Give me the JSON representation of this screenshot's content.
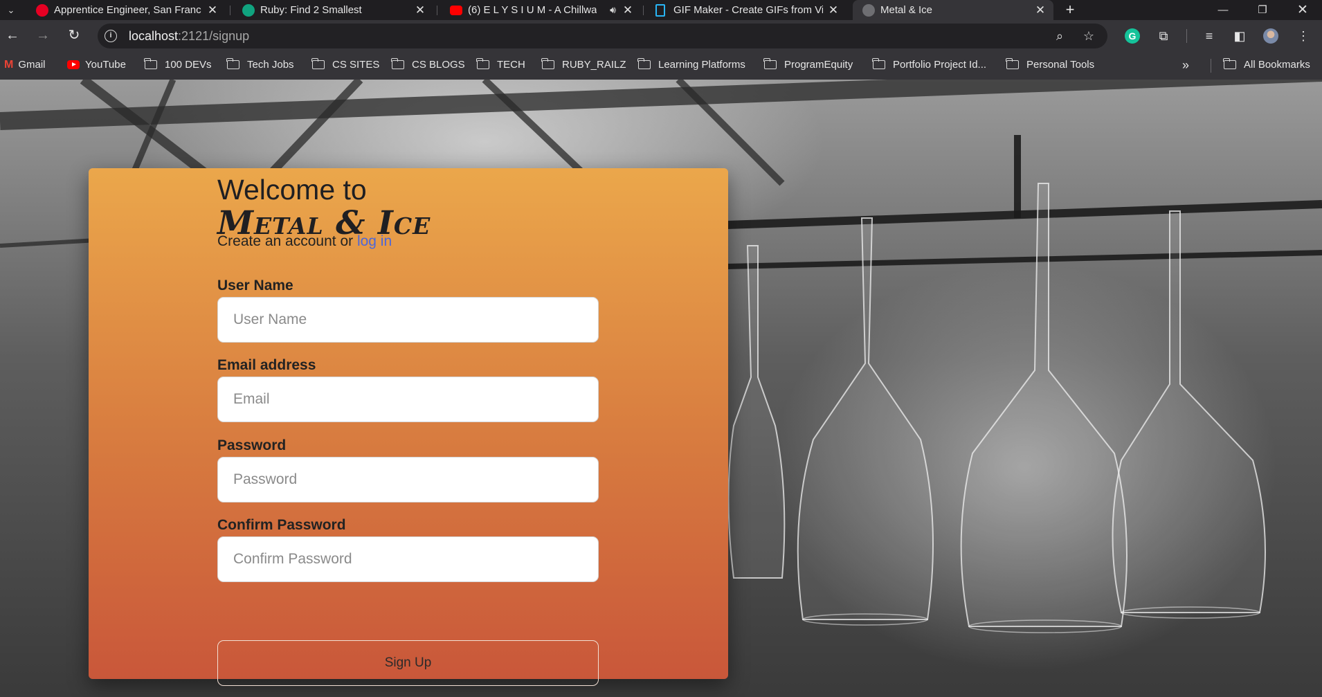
{
  "browser": {
    "tabs": [
      {
        "title": "Apprentice Engineer, San Franc",
        "icon": "pinterest-icon",
        "color": "#e60023"
      },
      {
        "title": "Ruby: Find 2 Smallest",
        "icon": "chatgpt-icon",
        "color": "#10a37f"
      },
      {
        "title": "(6) E L Y S I U M - A Chillwa",
        "icon": "youtube-icon",
        "color": "#ff0000"
      },
      {
        "title": "GIF Maker - Create GIFs from Vi",
        "icon": "document-icon",
        "color": "#29b6f6"
      },
      {
        "title": "Metal & Ice",
        "icon": "globe-icon",
        "color": "#7a7a7a"
      }
    ],
    "active_tab": 4,
    "url_host": "localhost",
    "url_path": ":2121/signup",
    "bookmarks": [
      {
        "label": "Gmail",
        "icon": "gmail-icon"
      },
      {
        "label": "YouTube",
        "icon": "youtube-icon"
      },
      {
        "label": "100 DEVs",
        "icon": "folder-icon"
      },
      {
        "label": "Tech Jobs",
        "icon": "folder-icon"
      },
      {
        "label": "CS SITES",
        "icon": "folder-icon"
      },
      {
        "label": "CS BLOGS",
        "icon": "folder-icon"
      },
      {
        "label": "TECH",
        "icon": "folder-icon"
      },
      {
        "label": "RUBY_RAILZ",
        "icon": "folder-icon"
      },
      {
        "label": "Learning Platforms",
        "icon": "folder-icon"
      },
      {
        "label": "ProgramEquity",
        "icon": "folder-icon"
      },
      {
        "label": "Portfolio Project Id...",
        "icon": "folder-icon"
      },
      {
        "label": "Personal Tools",
        "icon": "folder-icon"
      }
    ],
    "all_bookmarks": "All Bookmarks"
  },
  "page": {
    "welcome": "Welcome to",
    "brand": "Metal & Ice",
    "subline_prefix": "Create an account or ",
    "login_link": "log in",
    "fields": [
      {
        "label": "User Name",
        "placeholder": "User Name"
      },
      {
        "label": "Email address",
        "placeholder": "Email"
      },
      {
        "label": "Password",
        "placeholder": "Password"
      },
      {
        "label": "Confirm Password",
        "placeholder": "Confirm Password"
      }
    ],
    "submit": "Sign Up"
  },
  "colors": {
    "card_top": "#eba74b",
    "card_bottom": "#c9573a",
    "link": "#4d67d9"
  }
}
